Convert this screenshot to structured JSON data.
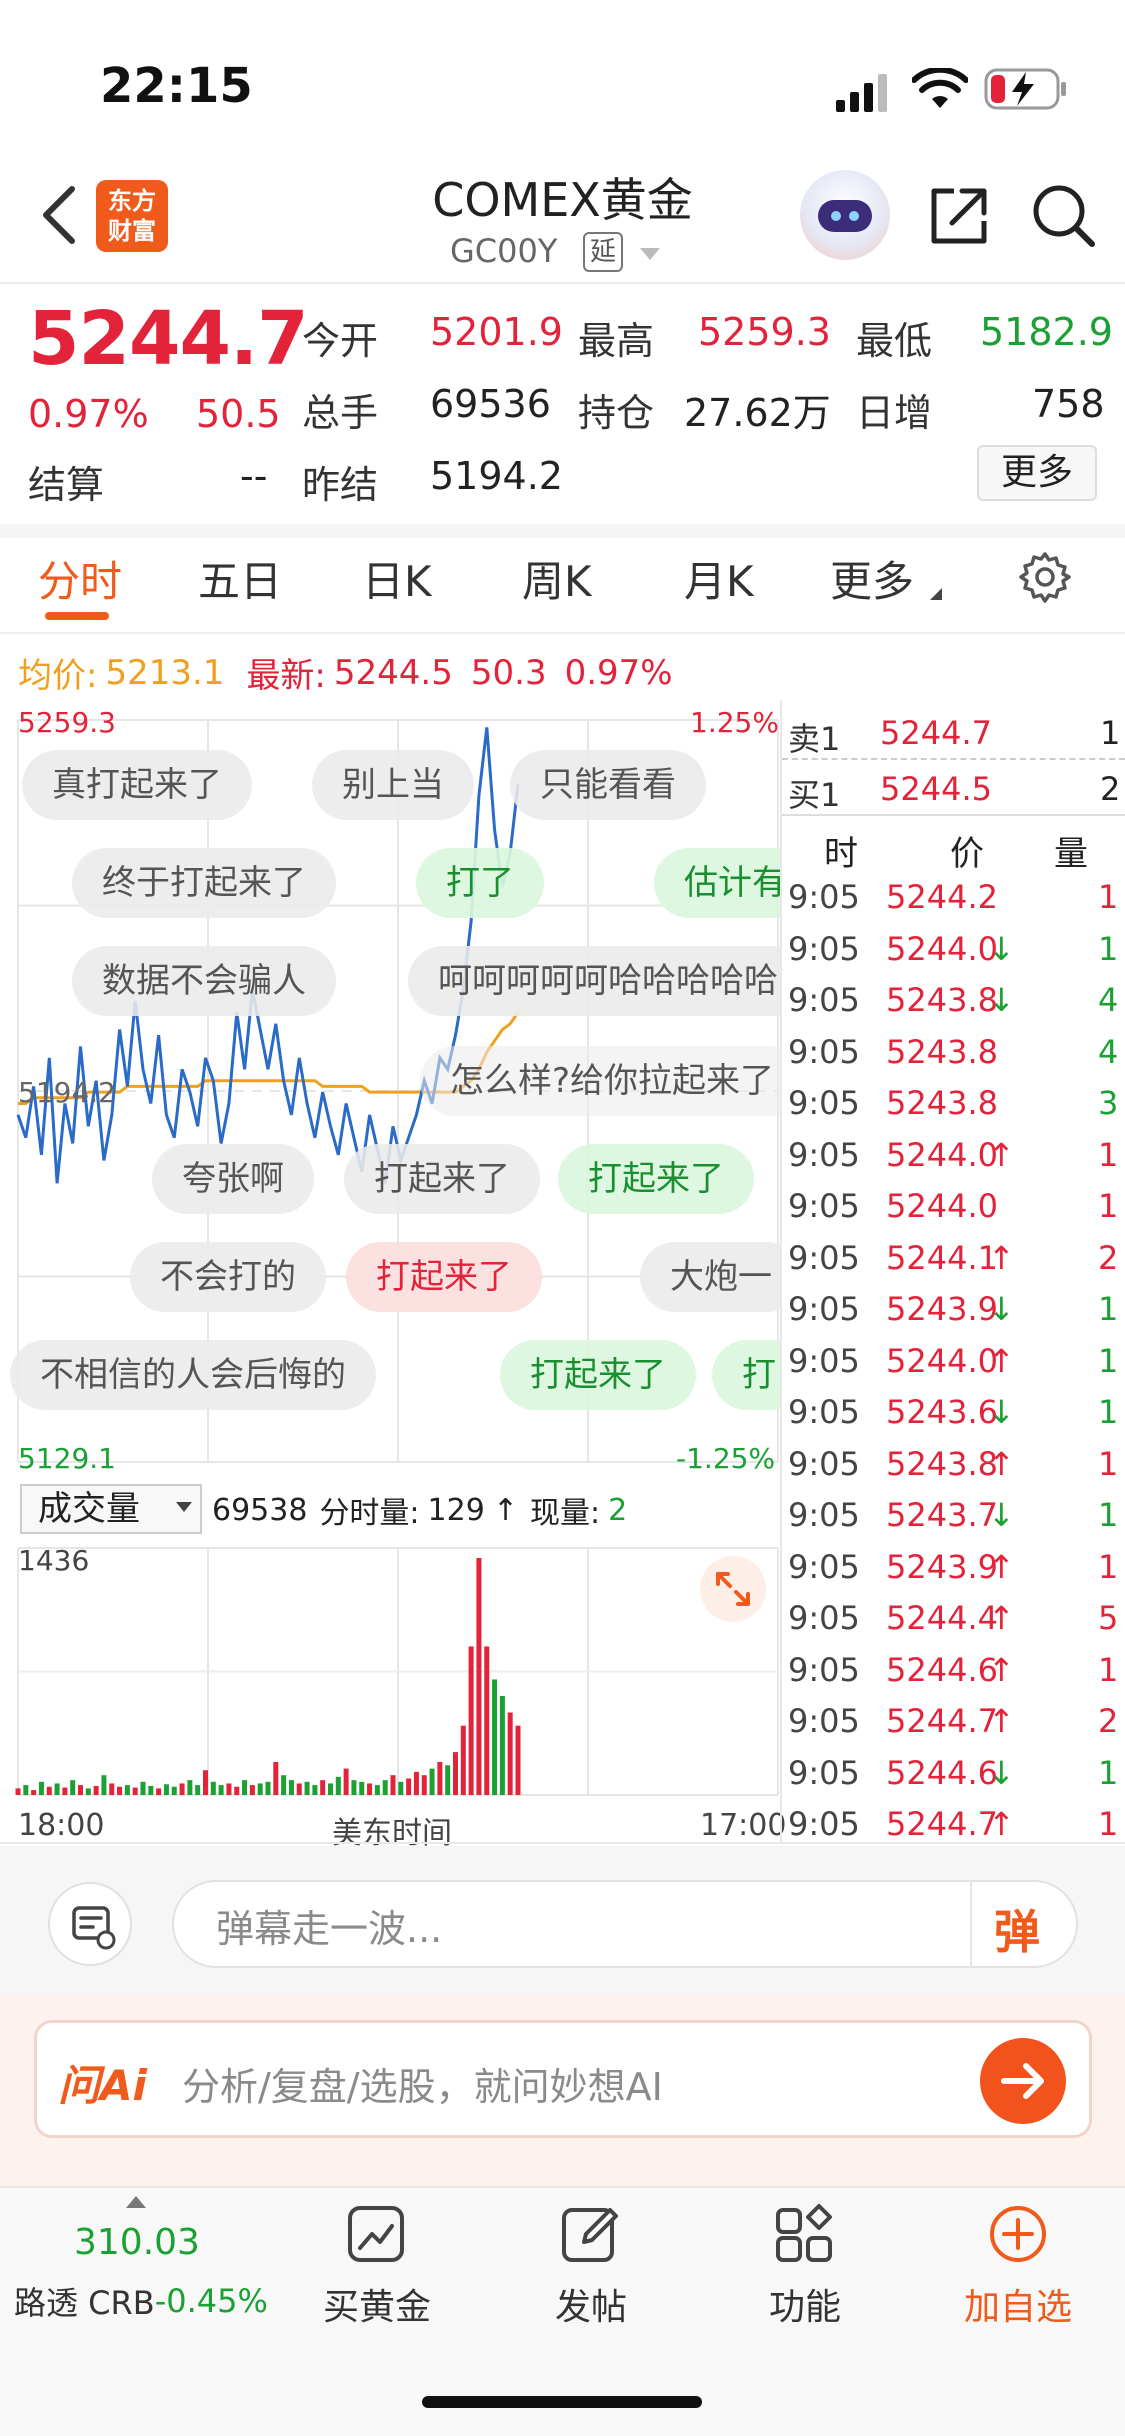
{
  "status_bar": {
    "time": "22:15"
  },
  "header": {
    "logo_line1": "东方",
    "logo_line2": "财富",
    "title": "COMEX黄金",
    "subtitle": "GC00Y",
    "delay_badge": "延"
  },
  "quote": {
    "price": "5244.7",
    "change_pct": "0.97%",
    "change": "50.5",
    "open_label": "今开",
    "open": "5201.9",
    "high_label": "最高",
    "high": "5259.3",
    "low_label": "最低",
    "low": "5182.9",
    "volume_label": "总手",
    "volume": "69536",
    "oi_label": "持仓",
    "oi": "27.62万",
    "daily_inc_label": "日增",
    "daily_inc": "758",
    "settle_label": "结算",
    "settle": "--",
    "prev_settle_label": "昨结",
    "prev_settle": "5194.2",
    "more_label": "更多"
  },
  "tabs": [
    {
      "label": "分时"
    },
    {
      "label": "五日"
    },
    {
      "label": "日K"
    },
    {
      "label": "周K"
    },
    {
      "label": "月K"
    },
    {
      "label": "更多"
    }
  ],
  "avg_row": {
    "avg_label": "均价:",
    "avg": "5213.1",
    "latest_label": "最新:",
    "latest": "5244.5",
    "latest_chg": "50.3",
    "latest_pct": "0.97%"
  },
  "chart": {
    "y_top": "5259.3",
    "y_bottom": "5129.1",
    "pct_top": "1.25%",
    "pct_bottom": "-1.25%",
    "mid_label": "5194.2",
    "vol_max": "1436",
    "x_start": "18:00",
    "x_mid": "美东时间",
    "x_end": "17:00"
  },
  "danmu": [
    {
      "text": "真打起来了",
      "style": "n"
    },
    {
      "text": "别上当",
      "style": "n"
    },
    {
      "text": "只能看看",
      "style": "n"
    },
    {
      "text": "终于打起来了",
      "style": "n"
    },
    {
      "text": "打了",
      "style": "g"
    },
    {
      "text": "估计有",
      "style": "g"
    },
    {
      "text": "数据不会骗人",
      "style": "n"
    },
    {
      "text": "呵呵呵呵呵哈哈哈哈哈",
      "style": "n"
    },
    {
      "text": "怎么样?给你拉起来了",
      "style": "n"
    },
    {
      "text": "夸张啊",
      "style": "n"
    },
    {
      "text": "打起来了",
      "style": "n"
    },
    {
      "text": "打起来了",
      "style": "g"
    },
    {
      "text": "不会打的",
      "style": "n"
    },
    {
      "text": "打起来了",
      "style": "r"
    },
    {
      "text": "大炮一",
      "style": "n"
    },
    {
      "text": "不相信的人会后悔的",
      "style": "n"
    },
    {
      "text": "打起来了",
      "style": "g"
    },
    {
      "text": "打",
      "style": "g"
    }
  ],
  "volume": {
    "selector_label": "成交量",
    "total": "69538",
    "tick_label": "分时量:",
    "tick_vol": "129",
    "now_label": "现量:",
    "now_vol": "2"
  },
  "order_book": {
    "sell": {
      "label": "卖1",
      "price": "5244.7",
      "qty": "1"
    },
    "buy": {
      "label": "买1",
      "price": "5244.5",
      "qty": "2"
    },
    "headers": [
      "时",
      "价",
      "量"
    ],
    "trades": [
      {
        "time": "9:05",
        "price": "5244.2",
        "dir": "",
        "qty": "1",
        "qc": "red"
      },
      {
        "time": "9:05",
        "price": "5244.0",
        "dir": "↓",
        "qty": "1",
        "qc": "green"
      },
      {
        "time": "9:05",
        "price": "5243.8",
        "dir": "↓",
        "qty": "4",
        "qc": "green"
      },
      {
        "time": "9:05",
        "price": "5243.8",
        "dir": "",
        "qty": "4",
        "qc": "green"
      },
      {
        "time": "9:05",
        "price": "5243.8",
        "dir": "",
        "qty": "3",
        "qc": "green"
      },
      {
        "time": "9:05",
        "price": "5244.0",
        "dir": "↑",
        "qty": "1",
        "qc": "red"
      },
      {
        "time": "9:05",
        "price": "5244.0",
        "dir": "",
        "qty": "1",
        "qc": "red"
      },
      {
        "time": "9:05",
        "price": "5244.1",
        "dir": "↑",
        "qty": "2",
        "qc": "red"
      },
      {
        "time": "9:05",
        "price": "5243.9",
        "dir": "↓",
        "qty": "1",
        "qc": "green"
      },
      {
        "time": "9:05",
        "price": "5244.0",
        "dir": "↑",
        "qty": "1",
        "qc": "green"
      },
      {
        "time": "9:05",
        "price": "5243.6",
        "dir": "↓",
        "qty": "1",
        "qc": "green"
      },
      {
        "time": "9:05",
        "price": "5243.8",
        "dir": "↑",
        "qty": "1",
        "qc": "red"
      },
      {
        "time": "9:05",
        "price": "5243.7",
        "dir": "↓",
        "qty": "1",
        "qc": "green"
      },
      {
        "time": "9:05",
        "price": "5243.9",
        "dir": "↑",
        "qty": "1",
        "qc": "red"
      },
      {
        "time": "9:05",
        "price": "5244.4",
        "dir": "↑",
        "qty": "5",
        "qc": "red"
      },
      {
        "time": "9:05",
        "price": "5244.6",
        "dir": "↑",
        "qty": "1",
        "qc": "red"
      },
      {
        "time": "9:05",
        "price": "5244.7",
        "dir": "↑",
        "qty": "2",
        "qc": "red"
      },
      {
        "time": "9:05",
        "price": "5244.6",
        "dir": "↓",
        "qty": "1",
        "qc": "green"
      },
      {
        "time": "9:05",
        "price": "5244.7",
        "dir": "↑",
        "qty": "1",
        "qc": "red"
      }
    ]
  },
  "danmu_input": {
    "placeholder": "弹幕走一波...",
    "send_label": "弹"
  },
  "ai_bar": {
    "logo": "问Ai",
    "placeholder": "分析/复盘/选股，就问妙想AI"
  },
  "bottom_bar": {
    "index_value": "310.03",
    "index_name": "路透 CRB",
    "index_change": "-0.45%",
    "buy_gold": "买黄金",
    "post": "发帖",
    "functions": "功能",
    "add_watch": "加自选"
  },
  "colors": {
    "up": "#e2233a",
    "down": "#1aa033",
    "accent": "#f05a1a",
    "price_line": "#2a6ac8",
    "avg_line": "#f0a020"
  },
  "chart_data": {
    "type": "line",
    "title": "",
    "xlabel": "美东时间",
    "ylabel": "",
    "x_range": [
      "18:00",
      "17:00"
    ],
    "ylim": [
      5129.1,
      5259.3
    ],
    "reference": 5194.2,
    "series": [
      {
        "values": [
          5190,
          5186,
          5195,
          5183,
          5200,
          5178,
          5192,
          5185,
          5202,
          5188,
          5196,
          5182,
          5190,
          5205,
          5195,
          5210,
          5198,
          5192,
          5204,
          5190,
          5186,
          5198,
          5194,
          5188,
          5200,
          5196,
          5185,
          5192,
          5208,
          5198,
          5212,
          5205,
          5198,
          5206,
          5196,
          5190,
          5200,
          5192,
          5186,
          5194,
          5188,
          5183,
          5192,
          5186,
          5180,
          5190,
          5184,
          5178,
          5188,
          5182,
          5186,
          5190,
          5196,
          5192,
          5200,
          5198,
          5204,
          5212,
          5224,
          5246,
          5258,
          5240,
          5230,
          5236,
          5248
        ]
      },
      {
        "values": [
          5192,
          5192,
          5193,
          5193,
          5193,
          5193,
          5193,
          5193,
          5193,
          5194,
          5194,
          5194,
          5194,
          5194,
          5195,
          5195,
          5195,
          5195,
          5195,
          5195,
          5195,
          5195,
          5195,
          5195,
          5196,
          5196,
          5196,
          5196,
          5196,
          5196,
          5196,
          5196,
          5196,
          5196,
          5196,
          5196,
          5196,
          5196,
          5196,
          5195,
          5195,
          5195,
          5195,
          5195,
          5195,
          5194,
          5194,
          5194,
          5194,
          5194,
          5194,
          5194,
          5194,
          5194,
          5194,
          5194,
          5194,
          5195,
          5196,
          5198,
          5201,
          5203,
          5205,
          5206,
          5208
        ]
      }
    ],
    "volume": [
      40,
      60,
      30,
      80,
      50,
      70,
      45,
      90,
      60,
      40,
      55,
      120,
      70,
      50,
      60,
      45,
      80,
      55,
      40,
      65,
      50,
      70,
      90,
      60,
      150,
      80,
      60,
      70,
      50,
      90,
      60,
      70,
      80,
      200,
      120,
      90,
      70,
      80,
      60,
      90,
      70,
      110,
      160,
      90,
      80,
      70,
      60,
      90,
      120,
      80,
      100,
      140,
      120,
      160,
      200,
      180,
      260,
      420,
      900,
      1436,
      900,
      700,
      600,
      500,
      420
    ]
  }
}
